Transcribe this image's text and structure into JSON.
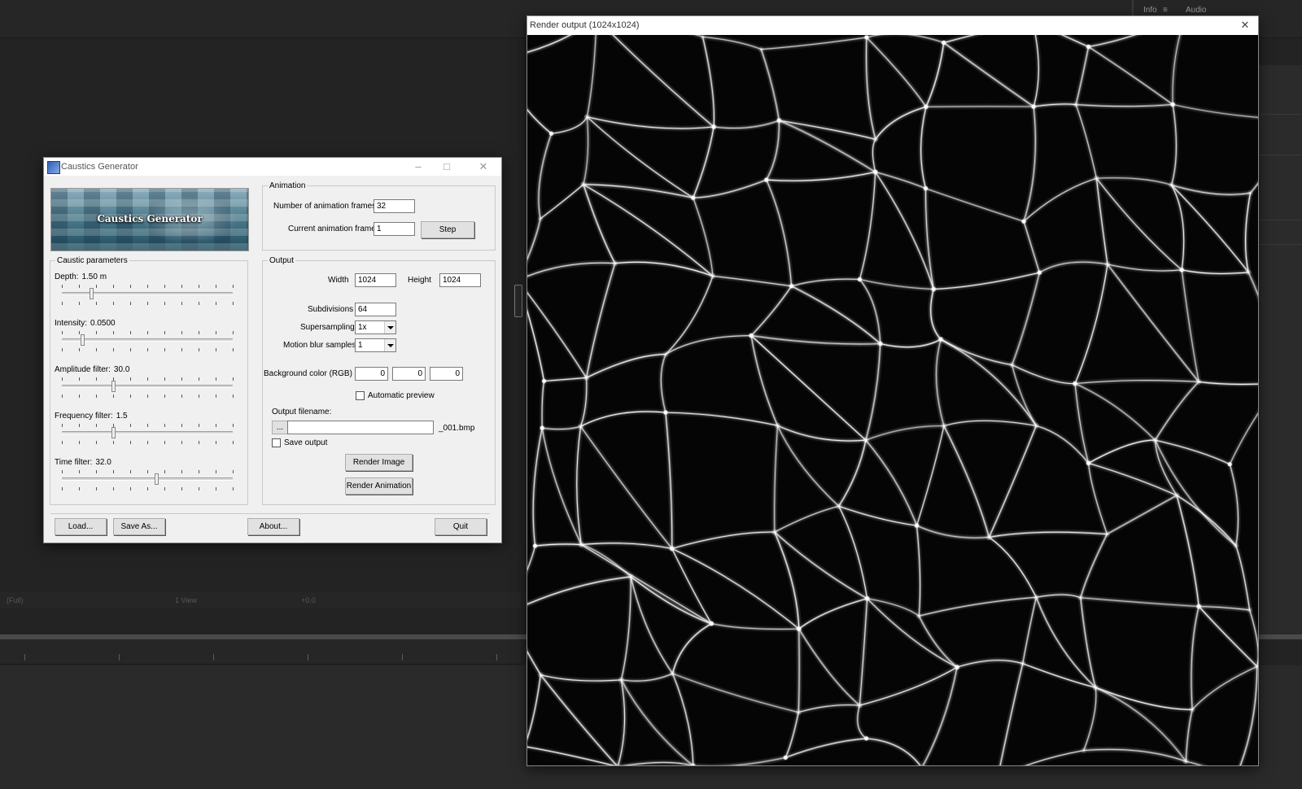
{
  "host": {
    "panel_tabs": [
      "Info",
      "Audio"
    ],
    "viewer_bar": [
      "(Full)",
      "1 View",
      "+0.0"
    ]
  },
  "dialog": {
    "title": "Caustics Generator",
    "banner_text": "Caustics Generator",
    "caustic_params": {
      "legend": "Caustic parameters",
      "sliders": [
        {
          "label": "Depth:",
          "value": "1.50 m",
          "position": 0.17
        },
        {
          "label": "Intensity:",
          "value": "0.0500",
          "position": 0.12
        },
        {
          "label": "Amplitude filter:",
          "value": "30.0",
          "position": 0.3
        },
        {
          "label": "Frequency filter:",
          "value": "1.5",
          "position": 0.3
        },
        {
          "label": "Time filter:",
          "value": "32.0",
          "position": 0.55
        }
      ]
    },
    "animation": {
      "legend": "Animation",
      "frames_label": "Number of animation frames",
      "frames_value": "32",
      "current_label": "Current animation frame",
      "current_value": "1",
      "step_button": "Step"
    },
    "output": {
      "legend": "Output",
      "width_label": "Width",
      "width_value": "1024",
      "height_label": "Height",
      "height_value": "1024",
      "subdivisions_label": "Subdivisions",
      "subdivisions_value": "64",
      "supersampling_label": "Supersampling",
      "supersampling_value": "1x",
      "motion_blur_label": "Motion blur samples",
      "motion_blur_value": "1",
      "bg_label": "Background color (RGB)",
      "bg_r": "0",
      "bg_g": "0",
      "bg_b": "0",
      "auto_preview_label": "Automatic preview",
      "auto_preview_checked": false,
      "filename_label": "Output filename:",
      "browse_button": "...",
      "filename_value": "",
      "filename_suffix": "_001.bmp",
      "save_output_label": "Save output",
      "save_output_checked": false,
      "render_image_button": "Render Image",
      "render_animation_button": "Render Animation"
    },
    "buttons": {
      "load": "Load...",
      "save_as": "Save As...",
      "about": "About...",
      "quit": "Quit"
    }
  },
  "render_window": {
    "title": "Render output (1024x1024)",
    "close_glyph": "✕"
  }
}
